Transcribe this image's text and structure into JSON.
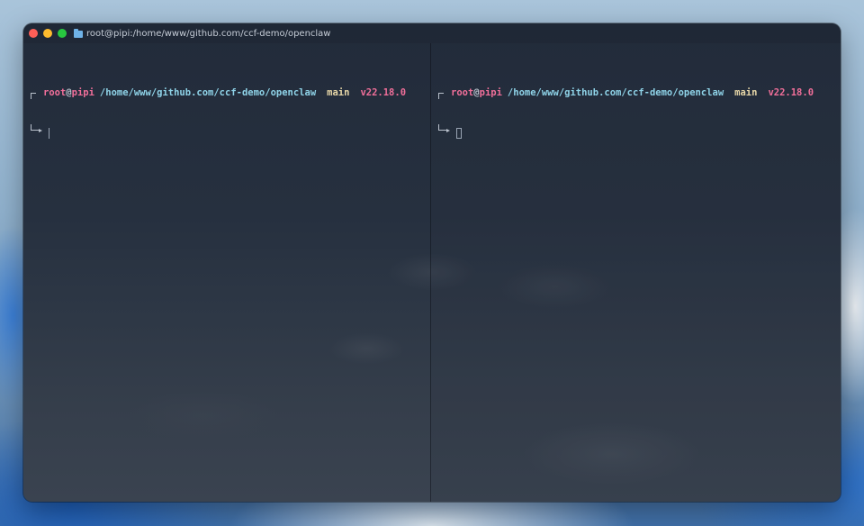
{
  "window": {
    "title": "root@pipi:/home/www/github.com/ccf-demo/openclaw"
  },
  "icons": {
    "title": "folder-icon",
    "close": "close-dot",
    "minimize": "minimize-dot",
    "maximize": "maximize-dot"
  },
  "colors": {
    "close": "#fe5f57",
    "minimize": "#febc2e",
    "maximize": "#28c840",
    "user": "#f16f9a",
    "path": "#8fd3e8",
    "branch": "#e8d7a8",
    "node_version": "#f16f9a"
  },
  "panes": [
    {
      "prompt": {
        "user": "root",
        "at": "@",
        "host": "pipi",
        "path": "/home/www/github.com/ccf-demo/openclaw",
        "branch": "main",
        "node_version": "v22.18.0"
      },
      "input": ""
    },
    {
      "prompt": {
        "user": "root",
        "at": "@",
        "host": "pipi",
        "path": "/home/www/github.com/ccf-demo/openclaw",
        "branch": "main",
        "node_version": "v22.18.0"
      },
      "input": ""
    }
  ]
}
